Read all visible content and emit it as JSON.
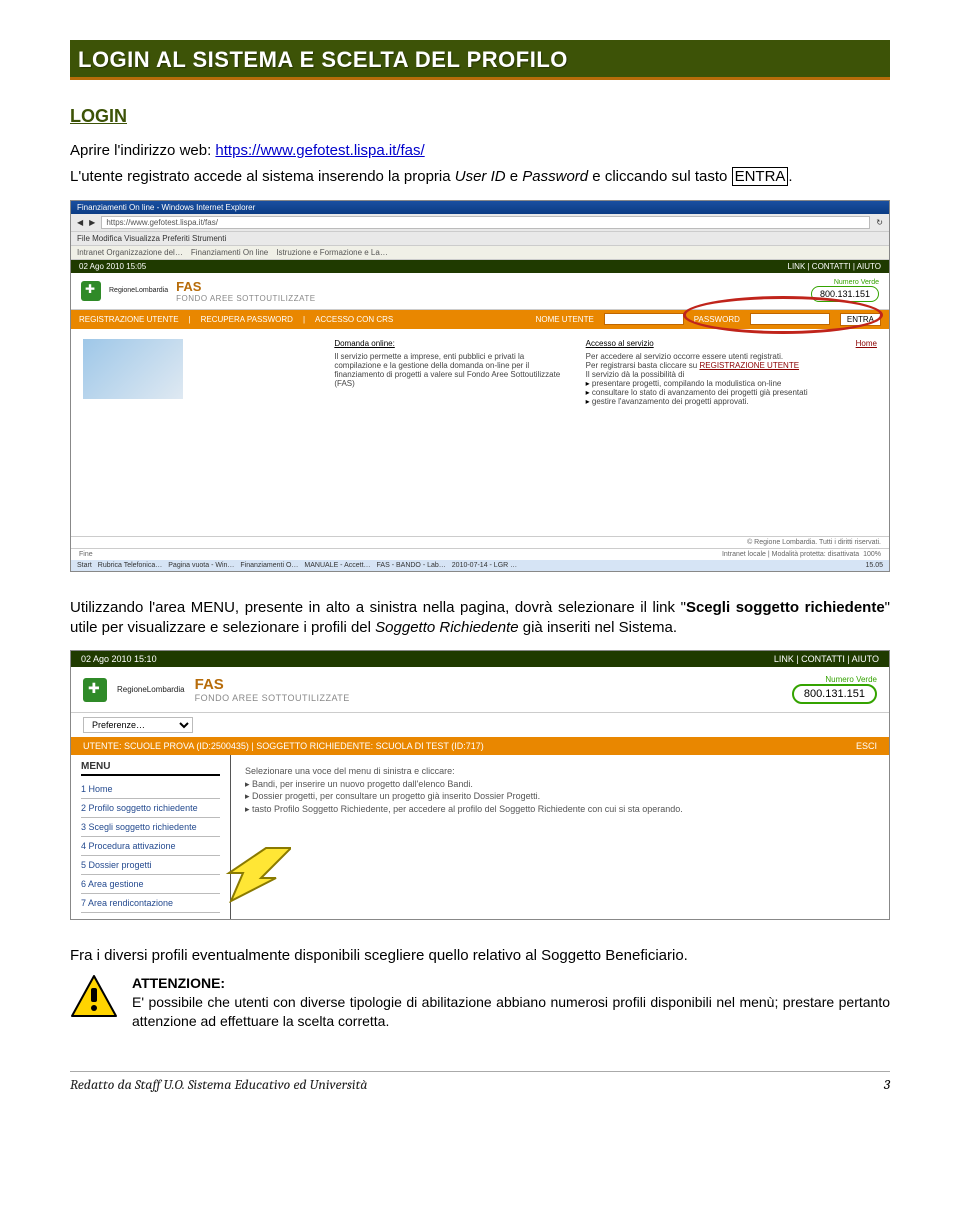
{
  "title": "LOGIN AL SISTEMA E SCELTA DEL PROFILO",
  "subhead": "LOGIN",
  "intro_line1_prefix": "Aprire l'indirizzo web: ",
  "intro_url": "https://www.gefotest.lispa.it/fas/",
  "intro_line2_a": "L'utente registrato accede al sistema inserendo la propria ",
  "intro_line2_userid": "User ID",
  "intro_line2_b": " e ",
  "intro_line2_pwd": "Password",
  "intro_line2_c": " e cliccando sul tasto ",
  "intro_line2_entra": "ENTRA",
  "intro_line2_d": ".",
  "para2_a": "Utilizzando l'area MENU, presente in alto a sinistra nella pagina, dovrà selezionare il link \"",
  "para2_b": "Scegli soggetto richiedente",
  "para2_c": "\" utile per visualizzare e selezionare i profili del ",
  "para2_d": "Soggetto Richiedente",
  "para2_e": " già inseriti nel Sistema.",
  "para3": "Fra i diversi profili eventualmente disponibili scegliere quello relativo al Soggetto Beneficiario.",
  "attn_title": "ATTENZIONE:",
  "attn_body": "E' possibile che utenti con diverse tipologie di abilitazione abbiano numerosi profili disponibili nel menù; prestare pertanto attenzione ad effettuare la scelta corretta.",
  "footer_left": "Redatto da Staff U.O. Sistema Educativo ed Università",
  "footer_right": "3",
  "shot1": {
    "wintitle": "Finanziamenti On line - Windows Internet Explorer",
    "address": "https://www.gefotest.lispa.it/fas/",
    "menu": "File   Modifica   Visualizza   Preferiti   Strumenti",
    "tabs": [
      "Intranet Organizzazione del…",
      "Finanziamenti On line",
      "Istruzione e Formazione e La…"
    ],
    "date": "02 Ago 2010 15:05",
    "links": "LINK   |   CONTATTI   |   AIUTO",
    "brand": "FAS",
    "brand_sub": "FONDO AREE SOTTOUTILIZZATE",
    "region": "RegioneLombardia",
    "numverde_lbl": "Numero Verde",
    "numverde": "800.131.151",
    "orange_left": [
      "REGISTRAZIONE UTENTE",
      "RECUPERA PASSWORD",
      "ACCESSO CON CRS"
    ],
    "orange_user": "NOME UTENTE",
    "orange_pwd": "PASSWORD",
    "orange_entra": "ENTRA",
    "col1_hd": "Domanda online:",
    "col1_tx": "Il servizio permette a imprese, enti pubblici e privati la compilazione e la gestione della domanda on-line per il finanziamento di progetti a valere sul Fondo Aree Sottoutilizzate (FAS)",
    "col2_hd": "Accesso al servizio",
    "col2_a": "Per accedere al servizio occorre essere utenti registrati.",
    "col2_b": "Per registrarsi basta cliccare su",
    "col2_link": "REGISTRAZIONE UTENTE",
    "col2_c": "Il servizio dà la possibilità di",
    "col2_li": [
      "presentare progetti, compilando la modulistica on-line",
      "consultare lo stato di avanzamento dei progetti già presentati",
      "gestire l'avanzamento dei progetti approvati."
    ],
    "home": "Home",
    "foot_right": "© Regione Lombardia. Tutti i diritti riservati.",
    "status": "Intranet locale | Modalità protetta: disattivata",
    "zoom": "100%",
    "start": "Start",
    "task": [
      "Rubrica Telefonica…",
      "Pagina vuota - Win…",
      "Finanziamenti O…",
      "MANUALE - Accett…",
      "FAS - BANDO - Lab…",
      "2010-07-14 - LGR …",
      "15.05"
    ]
  },
  "shot2": {
    "date": "02 Ago 2010 15:10",
    "links": "LINK   |   CONTATTI   |   AIUTO",
    "brand": "FAS",
    "brand_sub": "FONDO AREE SOTTOUTILIZZATE",
    "region": "RegioneLombardia",
    "numverde_lbl": "Numero Verde",
    "numverde": "800.131.151",
    "prefs": "Preferenze…",
    "orange": "UTENTE: SCUOLE PROVA (ID:2500435)  |  SOGGETTO RICHIEDENTE: SCUOLA DI TEST (ID:717)",
    "esci": "ESCI",
    "menu_hd": "MENU",
    "menu": [
      "1  Home",
      "2  Profilo soggetto richiedente",
      "3  Scegli soggetto richiedente",
      "4  Procedura attivazione",
      "5  Dossier progetti",
      "6  Area gestione",
      "7  Area rendicontazione"
    ],
    "rt0": "Selezionare una voce del menu di sinistra e cliccare:",
    "rt": [
      "Bandi, per inserire un nuovo progetto dall'elenco Bandi.",
      "Dossier progetti, per consultare un progetto già inserito Dossier Progetti.",
      "tasto Profilo Soggetto Richiedente, per accedere al profilo del Soggetto Richiedente con cui si sta operando."
    ]
  }
}
